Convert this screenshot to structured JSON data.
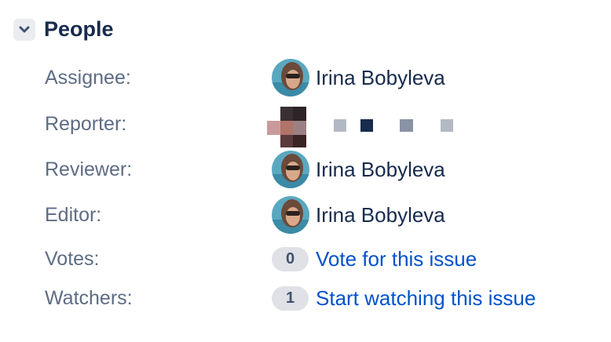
{
  "section": {
    "title": "People",
    "toggle_icon": "chevron-down-icon"
  },
  "assignee": {
    "label": "Assignee:",
    "name": "Irina Bobyleva"
  },
  "reporter": {
    "label": "Reporter:"
  },
  "reviewer": {
    "label": "Reviewer:",
    "name": "Irina Bobyleva"
  },
  "editor": {
    "label": "Editor:",
    "name": "Irina Bobyleva"
  },
  "votes": {
    "label": "Votes:",
    "count": "0",
    "action": "Vote for this issue"
  },
  "watchers": {
    "label": "Watchers:",
    "count": "1",
    "action": "Start watching this issue"
  },
  "colors": {
    "text": "#172b4d",
    "label": "#5e6c84",
    "link": "#0052cc",
    "badge": "#dfe1e6"
  }
}
